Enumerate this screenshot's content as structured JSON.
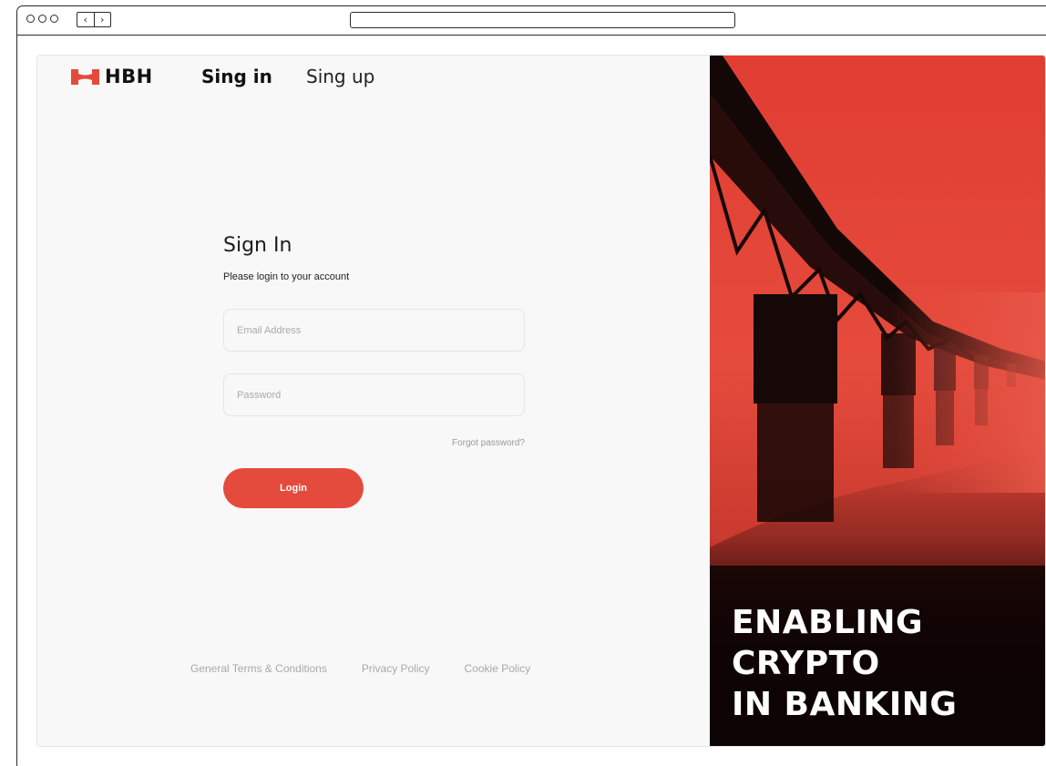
{
  "brand": {
    "name": "HBH",
    "accent_color": "#e54b3c",
    "logo_icon": "hbh-logo-mark"
  },
  "nav": {
    "signin_label": "Sing in",
    "signup_label": "Sing up"
  },
  "form": {
    "title": "Sign In",
    "subtitle": "Please login to your  account",
    "email_placeholder": "Email Address",
    "password_placeholder": "Password",
    "forgot_label": "Forgot password?",
    "login_label": "Login"
  },
  "footer": {
    "links": [
      "General Terms & Conditions",
      "Privacy Policy",
      "Cookie Policy"
    ]
  },
  "hero": {
    "lines": [
      "ENABLING",
      "CRYPTO",
      "IN BANKING"
    ],
    "image": "bridge-over-water-red-fog"
  }
}
